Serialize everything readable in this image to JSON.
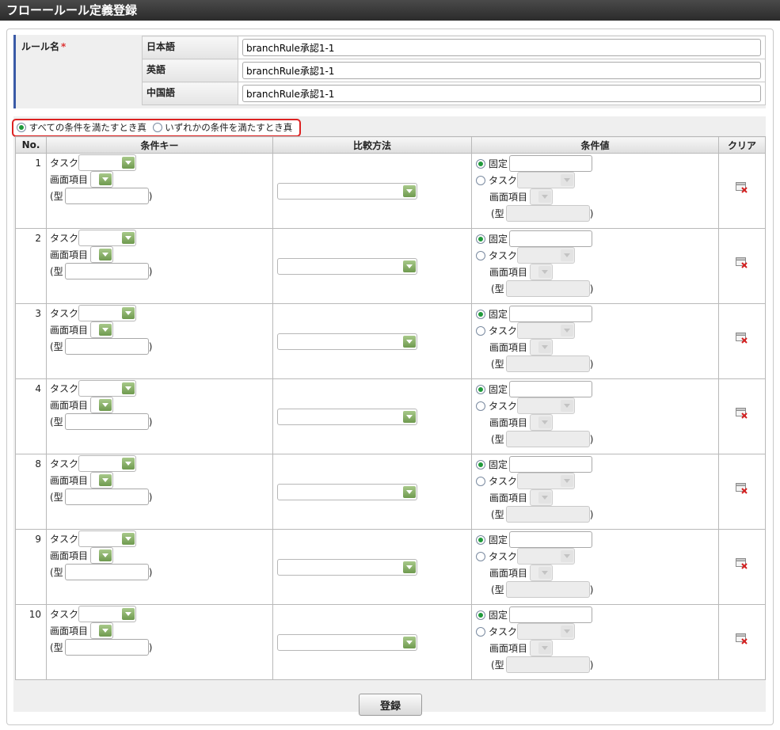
{
  "window": {
    "title": "フローールール定義登録"
  },
  "rule_name": {
    "label": "ルール名",
    "required_mark": "*",
    "languages": [
      {
        "label": "日本語",
        "value": "branchRule承認1-1"
      },
      {
        "label": "英語",
        "value": "branchRule承認1-1"
      },
      {
        "label": "中国語",
        "value": "branchRule承認1-1"
      }
    ]
  },
  "condition_mode": {
    "options": [
      {
        "label": "すべての条件を満たすとき真",
        "checked": true
      },
      {
        "label": "いずれかの条件を満たすとき真",
        "checked": false
      }
    ]
  },
  "table": {
    "headers": {
      "no": "No.",
      "key": "条件キー",
      "compare": "比較方法",
      "value": "条件値",
      "clear": "クリア"
    },
    "key_labels": {
      "task": "タスク",
      "screen_item": "画面項目",
      "type_open": "(型",
      "type_close": ")"
    },
    "value_labels": {
      "fixed": "固定",
      "task": "タスク",
      "screen_item": "画面項目",
      "type_open": "(型",
      "type_close": ")"
    },
    "rows": [
      {
        "no": "1"
      },
      {
        "no": "2"
      },
      {
        "no": "3"
      },
      {
        "no": "4"
      },
      {
        "no": "8"
      },
      {
        "no": "9"
      },
      {
        "no": "10"
      }
    ]
  },
  "actions": {
    "register_label": "登録"
  },
  "colors": {
    "accent": "#3a5aa6",
    "highlight": "#dd2222",
    "select_arrow": "#7aa35a"
  },
  "icons": {
    "clear": "delete-x-icon"
  }
}
